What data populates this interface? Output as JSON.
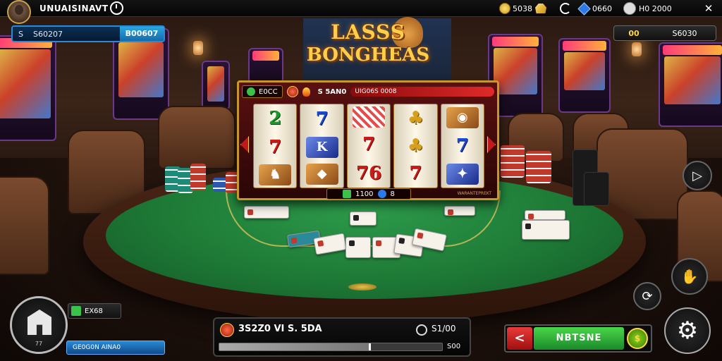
{
  "header": {
    "player_name": "UNUAISINAVT",
    "coins_value": "5038",
    "gems_value": "0660",
    "status_value": "H0 2000",
    "close_label": "✕"
  },
  "balances": {
    "left_label": "S",
    "left_value": "S60207",
    "left_badge": "B00607",
    "right_badge": "00",
    "right_value": "S6030"
  },
  "logo": {
    "line1": "LASSS",
    "line2": "BONGHEAS"
  },
  "slot": {
    "header_box1": "E0CC",
    "header_value": "S 5AN0",
    "header_bar": "UIG06S 0008",
    "reels": [
      [
        {
          "text": "2",
          "style": "green"
        },
        {
          "text": "7",
          "style": "red"
        },
        {
          "text": "♞",
          "style": "pic"
        }
      ],
      [
        {
          "text": "7",
          "style": "blue"
        },
        {
          "text": "K",
          "style": "pic blue-bg"
        },
        {
          "text": "◆",
          "style": "pic"
        }
      ],
      [
        {
          "text": "",
          "style": "pic check"
        },
        {
          "text": "7",
          "style": "red"
        },
        {
          "text": "76",
          "style": "red"
        }
      ],
      [
        {
          "text": "♣",
          "style": "gold"
        },
        {
          "text": "♣",
          "style": "gold"
        },
        {
          "text": "7",
          "style": "red"
        }
      ],
      [
        {
          "text": "◉",
          "style": "pic"
        },
        {
          "text": "7",
          "style": "blue"
        },
        {
          "text": "✦",
          "style": "pic blue-bg"
        }
      ]
    ],
    "footer_value1": "1100",
    "footer_value2": "8",
    "tag_text": "WARANTEPREKT"
  },
  "left_panel": {
    "home_label": "77",
    "badge_value": "EX68",
    "blue_bar_text": "GE0G0N AINA0"
  },
  "bet": {
    "text": "3S2Z0 VI S. 5DA",
    "amount": "S1/00",
    "max_label": "S00",
    "fill_fraction": 0.68
  },
  "action": {
    "back_label": "<",
    "main_label": "NBTSNE",
    "coin_label": "$"
  },
  "icons": {
    "play": "play-icon",
    "hands": "hands-icon",
    "refresh": "refresh-icon",
    "gear": "gear-icon"
  }
}
